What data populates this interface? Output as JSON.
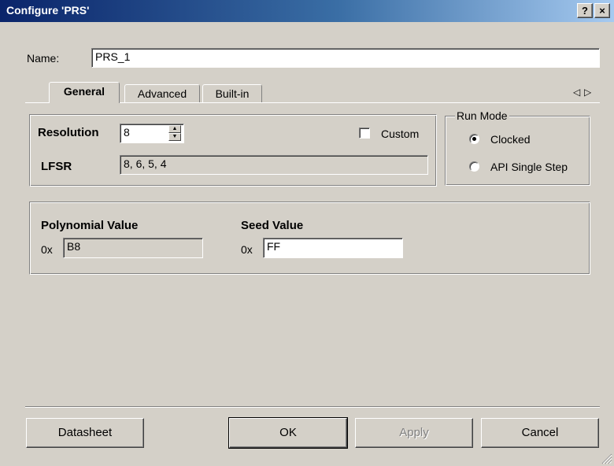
{
  "window": {
    "title": "Configure 'PRS'",
    "help_label": "?",
    "close_label": "×"
  },
  "name": {
    "label": "Name:",
    "value": "PRS_1"
  },
  "tabs": [
    {
      "label": "General",
      "active": true
    },
    {
      "label": "Advanced",
      "active": false
    },
    {
      "label": "Built-in",
      "active": false
    }
  ],
  "tab_scroll": {
    "left": "◁",
    "right": "▷"
  },
  "general": {
    "resolution_label": "Resolution",
    "resolution_value": "8",
    "custom_label": "Custom",
    "custom_checked": false,
    "lfsr_label": "LFSR",
    "lfsr_value": "8, 6, 5, 4",
    "run_mode": {
      "legend": "Run Mode",
      "options": [
        {
          "label": "Clocked",
          "selected": true
        },
        {
          "label": "API Single Step",
          "selected": false
        }
      ]
    },
    "polynomial": {
      "label": "Polynomial Value",
      "prefix": "0x",
      "value": "B8"
    },
    "seed": {
      "label": "Seed Value",
      "prefix": "0x",
      "value": "FF"
    }
  },
  "buttons": {
    "datasheet": "Datasheet",
    "ok": "OK",
    "apply": "Apply",
    "cancel": "Cancel"
  }
}
